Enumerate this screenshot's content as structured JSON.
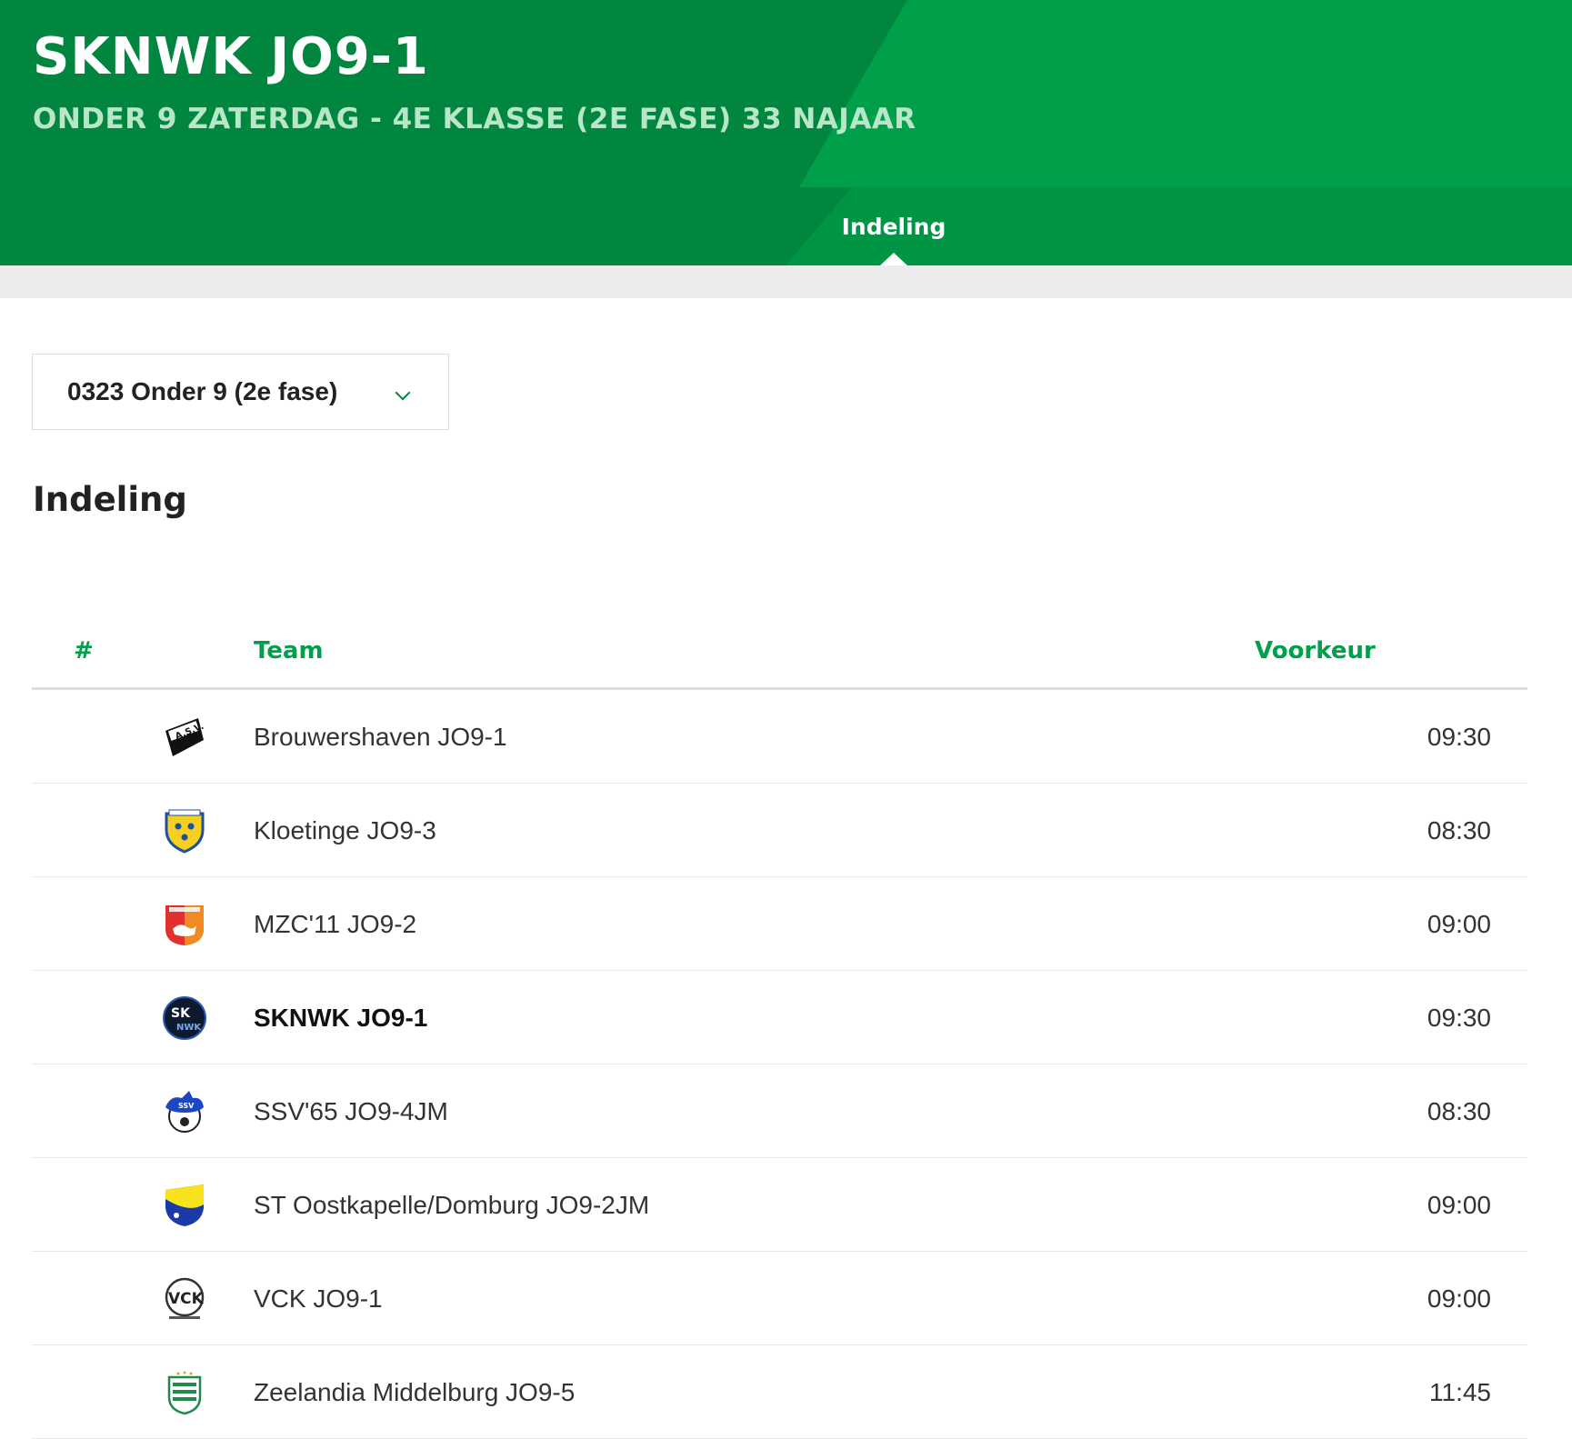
{
  "header": {
    "title": "SKNWK JO9-1",
    "subtitle": "ONDER 9 ZATERDAG - 4E KLASSE (2E FASE) 33 NAJAAR"
  },
  "tabs": [
    {
      "label": "Indeling",
      "active": true
    }
  ],
  "competition_select": {
    "value": "0323 Onder 9 (2e fase)"
  },
  "section": {
    "title": "Indeling"
  },
  "table": {
    "columns": {
      "number": "#",
      "team": "Team",
      "preference": "Voorkeur"
    },
    "rows": [
      {
        "team": "Brouwershaven JO9-1",
        "time": "09:30",
        "logo": "asv-logo-icon"
      },
      {
        "team": "Kloetinge JO9-3",
        "time": "08:30",
        "logo": "kloetinge-logo-icon"
      },
      {
        "team": "MZC'11 JO9-2",
        "time": "09:00",
        "logo": "mzc11-logo-icon"
      },
      {
        "team": "SKNWK JO9-1",
        "time": "09:30",
        "logo": "sknwk-logo-icon",
        "own_team": true
      },
      {
        "team": "SSV'65 JO9-4JM",
        "time": "08:30",
        "logo": "ssv65-logo-icon"
      },
      {
        "team": "ST Oostkapelle/Domburg JO9-2JM",
        "time": "09:00",
        "logo": "oostkapelle-logo-icon"
      },
      {
        "team": "VCK JO9-1",
        "time": "09:00",
        "logo": "vck-logo-icon"
      },
      {
        "team": "Zeelandia Middelburg JO9-5",
        "time": "11:45",
        "logo": "zeelandia-logo-icon"
      }
    ]
  },
  "colors": {
    "brand_green": "#00863f",
    "accent_green": "#00a04a",
    "subtitle_green": "#b7e6c8"
  }
}
